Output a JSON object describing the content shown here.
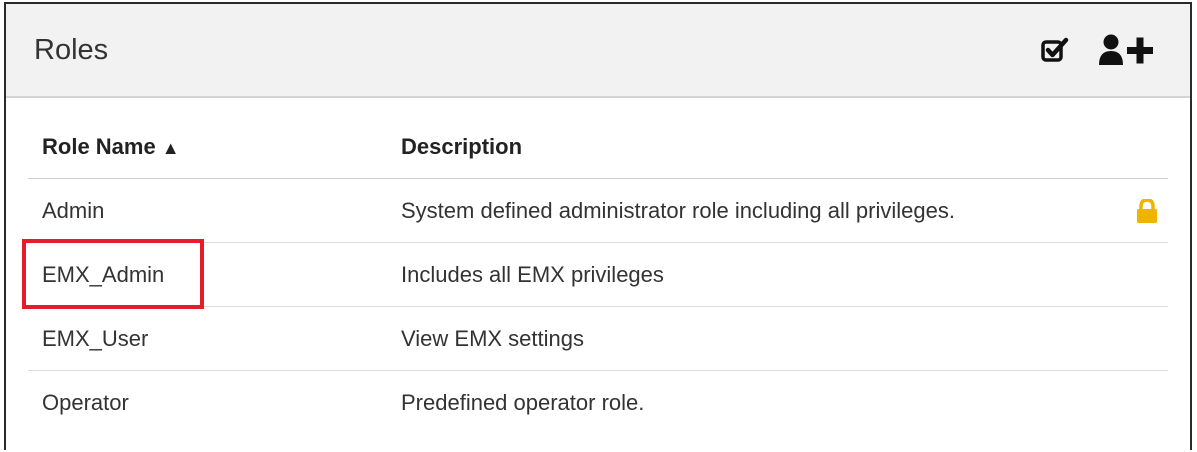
{
  "panel": {
    "title": "Roles",
    "icons": [
      "batch-select-icon",
      "add-user-icon"
    ]
  },
  "table": {
    "columns": {
      "name": "Role Name",
      "sort_indicator": "▲",
      "description": "Description"
    },
    "rows": [
      {
        "name": "Admin",
        "description": "System defined administrator role including all privileges.",
        "locked": true
      },
      {
        "name": "EMX_Admin",
        "description": "Includes all EMX privileges",
        "locked": false
      },
      {
        "name": "EMX_User",
        "description": "View EMX settings",
        "locked": false
      },
      {
        "name": "Operator",
        "description": "Predefined operator role.",
        "locked": false
      }
    ]
  },
  "colors": {
    "highlight": "#e41d2b",
    "lock": "#f0b400",
    "header_bg": "#f2f2f2"
  }
}
